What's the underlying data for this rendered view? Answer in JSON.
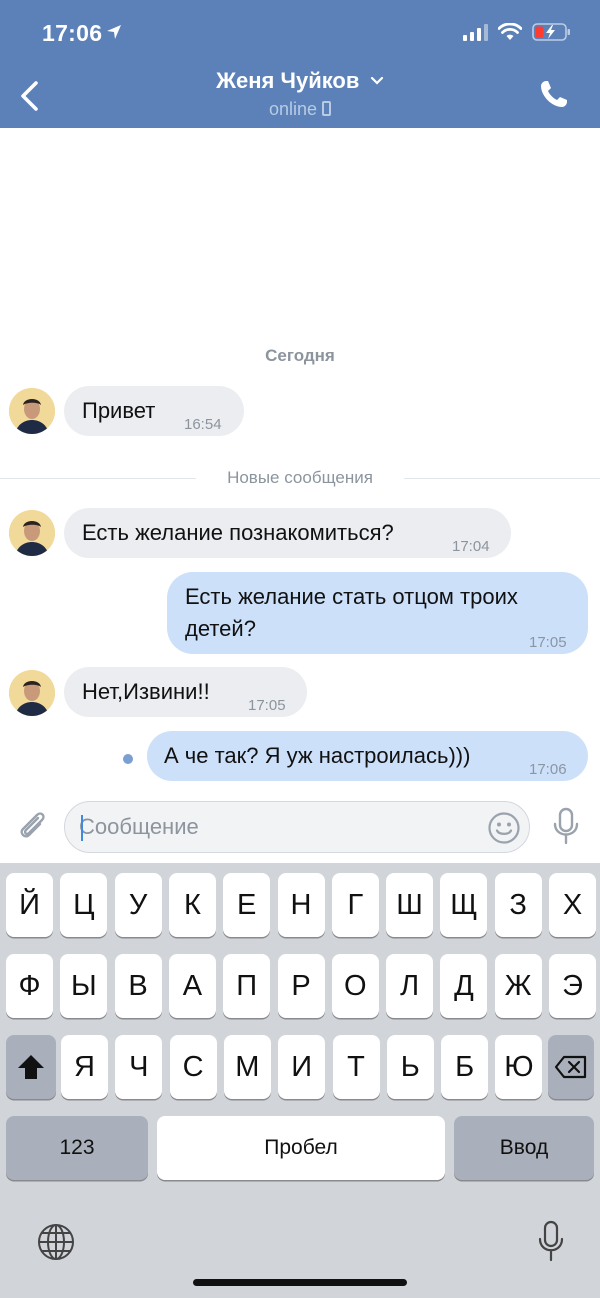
{
  "status_bar": {
    "time": "17:06"
  },
  "header": {
    "title": "Женя Чуйков",
    "status": "online"
  },
  "chat": {
    "date_separator": "Сегодня",
    "new_messages_label": "Новые сообщения",
    "messages": [
      {
        "direction": "in",
        "text": "Привет",
        "time": "16:54"
      },
      {
        "direction": "in",
        "text": "Есть желание познакомиться?",
        "time": "17:04"
      },
      {
        "direction": "out",
        "text": "Есть желание стать отцом троих детей?",
        "time": "17:05"
      },
      {
        "direction": "in",
        "text": "Нет,Извини!!",
        "time": "17:05"
      },
      {
        "direction": "out",
        "text": "А че так? Я уж настроилась)))",
        "time": "17:06",
        "unread": true
      }
    ]
  },
  "composer": {
    "placeholder": "Сообщение",
    "value": ""
  },
  "keyboard": {
    "row1": [
      "Й",
      "Ц",
      "У",
      "К",
      "Е",
      "Н",
      "Г",
      "Ш",
      "Щ",
      "З",
      "Х"
    ],
    "row2": [
      "Ф",
      "Ы",
      "В",
      "А",
      "П",
      "Р",
      "О",
      "Л",
      "Д",
      "Ж",
      "Э"
    ],
    "row3": [
      "Я",
      "Ч",
      "С",
      "М",
      "И",
      "Т",
      "Ь",
      "Б",
      "Ю"
    ],
    "numbers_label": "123",
    "space_label": "Пробел",
    "enter_label": "Ввод"
  },
  "colors": {
    "header_bg": "#5b81b8",
    "incoming_bubble": "#ebedf0",
    "outgoing_bubble": "#cce0fa",
    "keyboard_bg": "#d1d4d9"
  }
}
